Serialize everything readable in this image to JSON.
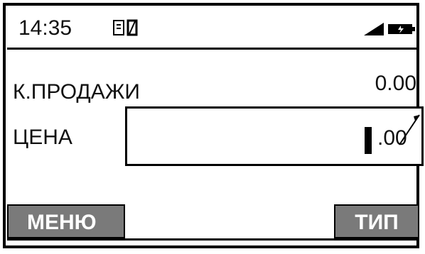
{
  "status": {
    "time": "14:35",
    "sim_icon": "sim-card-icon",
    "signal_icon": "signal-strength-icon",
    "battery_icon": "battery-icon"
  },
  "rows": {
    "sales_code_label": "К.ПРОДАЖИ",
    "sales_code_value": "0.00",
    "price_label": "ЦЕНА",
    "price_value": ".00"
  },
  "softkeys": {
    "left_label": "МЕНЮ",
    "right_label": "ТИП"
  },
  "colors": {
    "softkey_bg": "#7a7a7a",
    "text": "#111111",
    "border": "#000000"
  }
}
